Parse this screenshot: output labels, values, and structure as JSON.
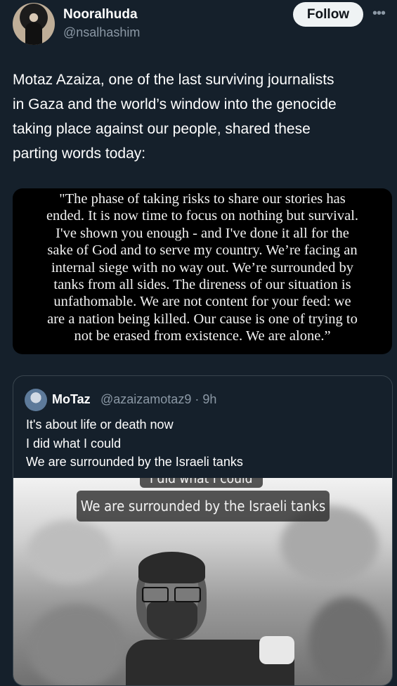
{
  "post": {
    "author_name": "Nooralhuda",
    "author_handle": "@nsalhashim",
    "follow_label": "Follow",
    "more_label": "•••",
    "text_lines": [
      "Motaz Azaiza, one of the last surviving journalists",
      "in Gaza and the world’s window into the genocide",
      "taking place against our people, shared these",
      "parting words today:"
    ]
  },
  "quote_image": {
    "lines": [
      "\"The phase of taking risks to share our stories has",
      "ended. It is now time to focus on nothing but survival.",
      "I've shown you enough - and I've done it all for the",
      "sake of God and to serve my country. We’re facing an",
      "internal siege with no way out. We’re surrounded by",
      "tanks from all sides. The direness of our situation is",
      "unfathomable. We are not content for your feed: we",
      "are a nation being killed. Our cause is one of trying to",
      "not be erased from existence. We are alone.”"
    ]
  },
  "quoted_tweet": {
    "author_name": "MoTaz",
    "author_handle": "@azaizamotaz9 · 9h",
    "text_lines": [
      "It's about life or death now",
      "I did what I could",
      "We are surrounded by the Israeli tanks"
    ],
    "media_captions": [
      "I did what I could",
      "We are surrounded by the Israeli tanks"
    ]
  }
}
